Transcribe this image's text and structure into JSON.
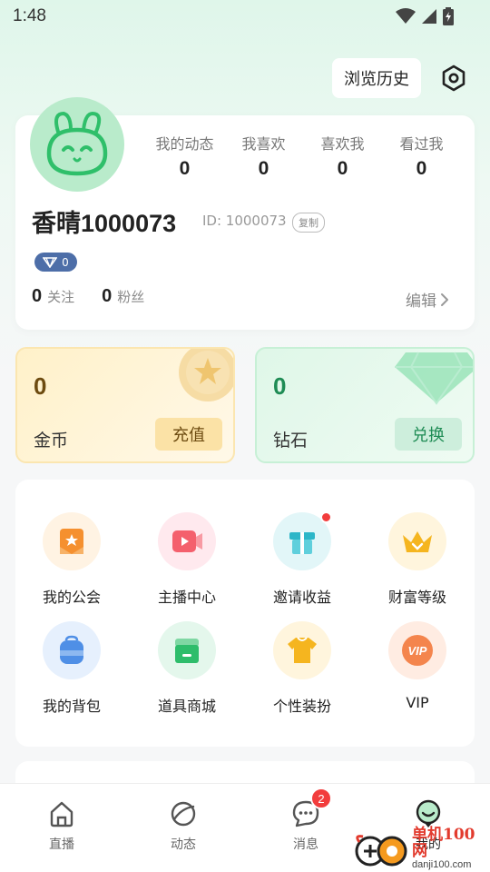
{
  "status_bar": {
    "time": "1:48"
  },
  "header": {
    "history_label": "浏览历史"
  },
  "profile": {
    "stats": [
      {
        "label": "我的动态",
        "value": "0"
      },
      {
        "label": "我喜欢",
        "value": "0"
      },
      {
        "label": "喜欢我",
        "value": "0"
      },
      {
        "label": "看过我",
        "value": "0"
      }
    ],
    "nickname": "香晴1000073",
    "user_id": "ID: 1000073",
    "copy_label": "复制",
    "level": "0",
    "following_count": "0",
    "following_label": "关注",
    "fans_count": "0",
    "fans_label": "粉丝",
    "edit_label": "编辑"
  },
  "wallet": {
    "gold": {
      "value": "0",
      "label": "金币",
      "button": "充值"
    },
    "diamond": {
      "value": "0",
      "label": "钻石",
      "button": "兑换"
    }
  },
  "services": [
    {
      "label": "我的公会",
      "icon": "guild-icon",
      "color": "#f5902f"
    },
    {
      "label": "主播中心",
      "icon": "video-icon",
      "color": "#f4606d"
    },
    {
      "label": "邀请收益",
      "icon": "gift-icon",
      "color": "#2db6c8"
    },
    {
      "label": "财富等级",
      "icon": "crown-icon",
      "color": "#f5b51f"
    },
    {
      "label": "我的背包",
      "icon": "backpack-icon",
      "color": "#4f8fe6"
    },
    {
      "label": "道具商城",
      "icon": "shop-icon",
      "color": "#2ebd6b"
    },
    {
      "label": "个性装扮",
      "icon": "shirt-icon",
      "color": "#f5b51f"
    },
    {
      "label": "VIP",
      "icon": "vip-icon",
      "color": "#f37a3d"
    }
  ],
  "bottom_nav": [
    {
      "label": "直播"
    },
    {
      "label": "动态"
    },
    {
      "label": "消息",
      "badge": "2"
    },
    {
      "label": "我的"
    }
  ],
  "watermark": {
    "brand": "单机100网",
    "url": "danji100.com"
  }
}
